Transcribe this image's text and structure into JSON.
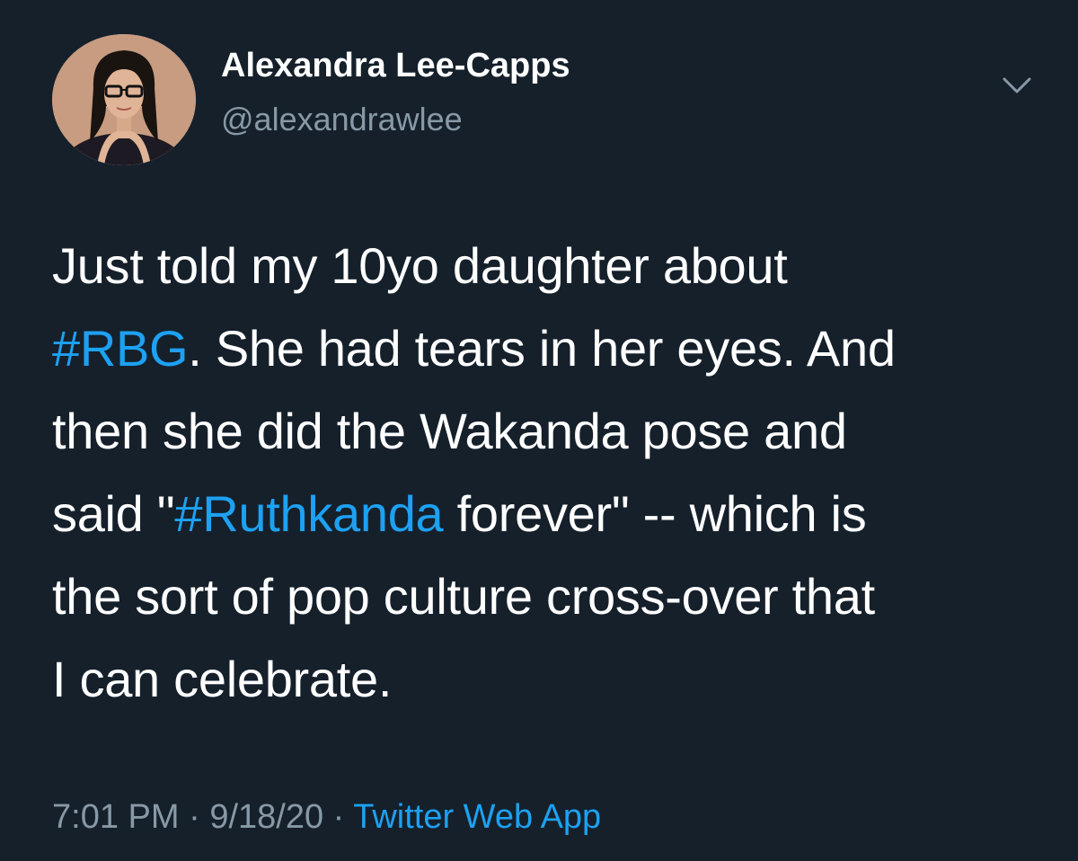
{
  "author": {
    "name": "Alexandra Lee-Capps",
    "handle": "@alexandrawlee"
  },
  "tweet": {
    "line1": "Just told my 10yo daughter about",
    "line2_hashtag": "#RBG",
    "line2_rest": ". She had tears in her eyes. And",
    "line3": "then she did the Wakanda pose and",
    "line4_prefix": "said \"",
    "line4_hashtag": "#Ruthkanda",
    "line4_suffix": " forever\" -- which is",
    "line5": "the sort of pop culture cross-over that",
    "line6": "I can celebrate."
  },
  "meta": {
    "time": "7:01 PM",
    "separator": " · ",
    "date": "9/18/20",
    "source": "Twitter Web App"
  },
  "icons": {
    "caret": "chevron-down-icon",
    "avatar": "avatar"
  },
  "colors": {
    "background": "#15202b",
    "text": "#ffffff",
    "secondary": "#8899a6",
    "link": "#1da1f2"
  }
}
